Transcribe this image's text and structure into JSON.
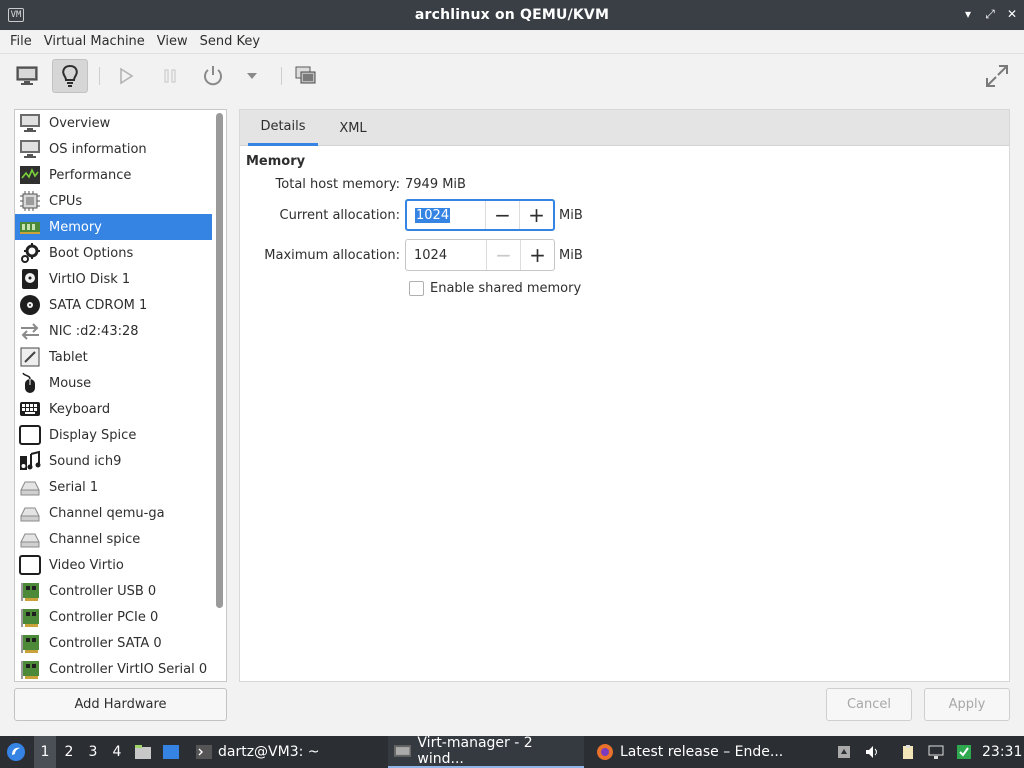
{
  "window": {
    "title": "archlinux on QEMU/KVM",
    "app_icon_text": "VM",
    "controls": [
      "minimize-icon",
      "restore-icon",
      "close-icon"
    ]
  },
  "menu": [
    "File",
    "Virtual Machine",
    "View",
    "Send Key"
  ],
  "toolbar": {
    "buttons": [
      "console-icon",
      "details-bulb-icon",
      "run-icon",
      "pause-icon",
      "power-icon",
      "power-menu-chevron-icon",
      "snapshots-icon",
      "fullscreen-icon"
    ]
  },
  "sidebar": {
    "items": [
      {
        "label": "Overview",
        "icon": "monitor-icon"
      },
      {
        "label": "OS information",
        "icon": "monitor-icon"
      },
      {
        "label": "Performance",
        "icon": "performance-icon"
      },
      {
        "label": "CPUs",
        "icon": "cpu-icon"
      },
      {
        "label": "Memory",
        "icon": "memory-icon",
        "selected": true
      },
      {
        "label": "Boot Options",
        "icon": "gears-icon"
      },
      {
        "label": "VirtIO Disk 1",
        "icon": "disk-icon"
      },
      {
        "label": "SATA CDROM 1",
        "icon": "cdrom-icon"
      },
      {
        "label": "NIC :d2:43:28",
        "icon": "network-arrows-icon"
      },
      {
        "label": "Tablet",
        "icon": "tablet-icon"
      },
      {
        "label": "Mouse",
        "icon": "mouse-icon"
      },
      {
        "label": "Keyboard",
        "icon": "keyboard-icon"
      },
      {
        "label": "Display Spice",
        "icon": "display-icon"
      },
      {
        "label": "Sound ich9",
        "icon": "sound-icon"
      },
      {
        "label": "Serial 1",
        "icon": "serial-icon"
      },
      {
        "label": "Channel qemu-ga",
        "icon": "channel-icon"
      },
      {
        "label": "Channel spice",
        "icon": "channel-icon"
      },
      {
        "label": "Video Virtio",
        "icon": "video-icon"
      },
      {
        "label": "Controller USB 0",
        "icon": "controller-card-icon"
      },
      {
        "label": "Controller PCIe 0",
        "icon": "controller-card-icon"
      },
      {
        "label": "Controller SATA 0",
        "icon": "controller-card-icon"
      },
      {
        "label": "Controller VirtIO Serial 0",
        "icon": "controller-card-icon"
      }
    ],
    "add_hardware": "Add Hardware"
  },
  "tabs": [
    {
      "label": "Details",
      "active": true
    },
    {
      "label": "XML",
      "active": false
    }
  ],
  "memory": {
    "section_title": "Memory",
    "total_host_label": "Total host memory:",
    "total_host_value": "7949 MiB",
    "current_label": "Current allocation:",
    "current_value": "1024",
    "maximum_label": "Maximum allocation:",
    "maximum_value": "1024",
    "unit": "MiB",
    "shared_label": "Enable shared memory",
    "shared_checked": false
  },
  "buttons": {
    "cancel": "Cancel",
    "apply": "Apply"
  },
  "taskbar": {
    "workspaces": [
      "1",
      "2",
      "3",
      "4"
    ],
    "active_workspace": "1",
    "tasks": [
      {
        "label": "dartz@VM3: ~",
        "icon": "terminal-icon"
      },
      {
        "label": "Virt-manager - 2 wind...",
        "icon": "virt-manager-icon",
        "active": true
      },
      {
        "label": "Latest release – Ende...",
        "icon": "firefox-icon"
      }
    ],
    "clock": "23:31",
    "colors": {
      "accent": "#3584e4",
      "panel": "#2b2e33"
    }
  }
}
